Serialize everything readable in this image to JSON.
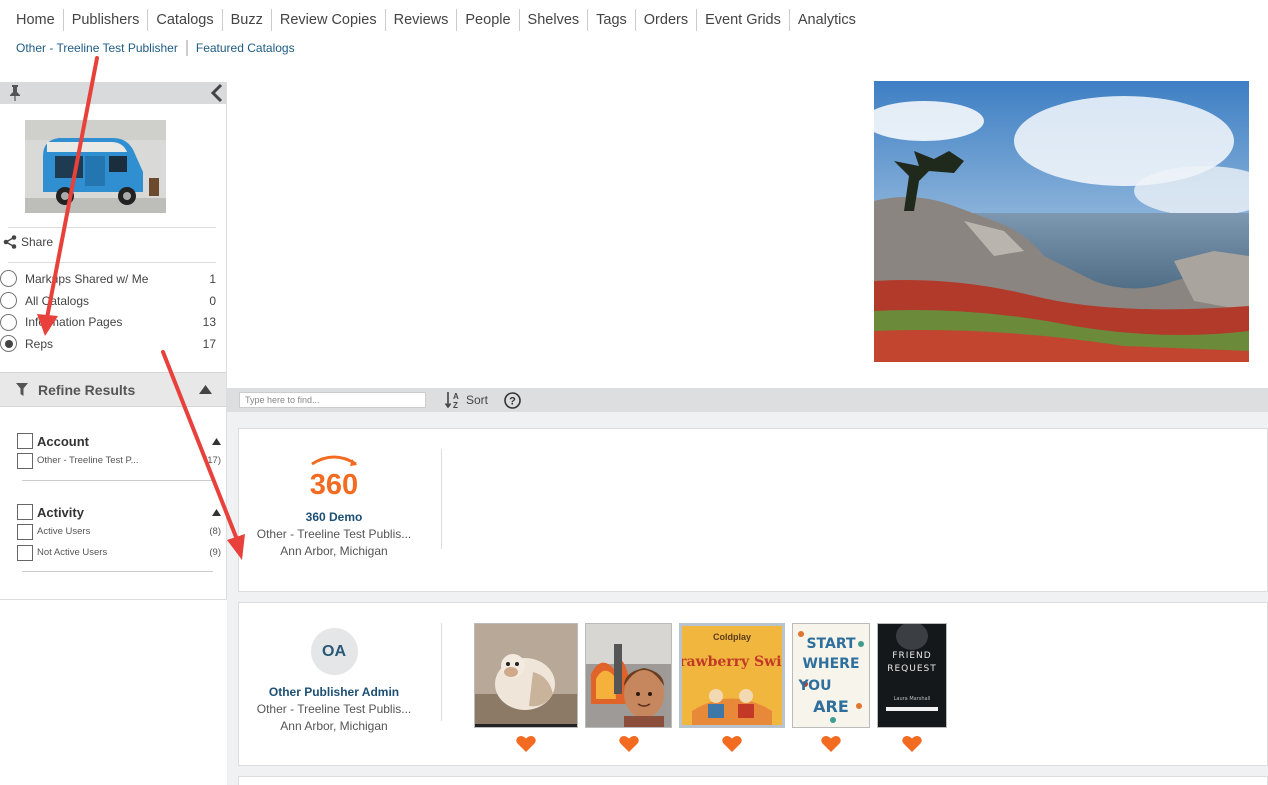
{
  "nav": {
    "items": [
      "Home",
      "Publishers",
      "Catalogs",
      "Buzz",
      "Review Copies",
      "Reviews",
      "People",
      "Shelves",
      "Tags",
      "Orders",
      "Event Grids",
      "Analytics"
    ]
  },
  "breadcrumb": [
    "Other - Treeline Test Publisher",
    "Featured Catalogs"
  ],
  "sidebar": {
    "share_label": "Share",
    "views": [
      {
        "label": "Markups Shared w/ Me",
        "count": "1",
        "checked": false
      },
      {
        "label": "All Catalogs",
        "count": "0",
        "checked": false
      },
      {
        "label": "Information Pages",
        "count": "13",
        "checked": false
      },
      {
        "label": "Reps",
        "count": "17",
        "checked": true
      }
    ],
    "refine_title": "Refine Results",
    "facets": [
      {
        "title": "Account",
        "options": [
          {
            "label": "Other - Treeline Test P...",
            "count": "(17)"
          }
        ]
      },
      {
        "title": "Activity",
        "options": [
          {
            "label": "Active Users",
            "count": "(8)"
          },
          {
            "label": "Not Active Users",
            "count": "(9)"
          }
        ]
      }
    ]
  },
  "toolbar": {
    "search_placeholder": "Type here to find...",
    "sort_label": "Sort"
  },
  "reps": [
    {
      "logo_text": "360",
      "name": "360 Demo",
      "org": "Other - Treeline Test Publis...",
      "location": "Ann Arbor, Michigan"
    },
    {
      "initials": "OA",
      "name": "Other Publisher Admin",
      "org": "Other - Treeline Test Publis...",
      "location": "Ann Arbor, Michigan",
      "books": [
        {
          "title": "",
          "author": ""
        },
        {
          "title": "",
          "author": ""
        },
        {
          "title": "Strawberry Swing",
          "author": "Coldplay"
        },
        {
          "title": "Start Where You Are",
          "author": ""
        },
        {
          "title": "Friend Request",
          "author": "Laura Marshall"
        }
      ]
    }
  ],
  "colors": {
    "link": "#1d5b84",
    "accent_orange": "#f26b21",
    "annotation_red": "#e8413b",
    "toolbar_bg": "#dcdedf"
  }
}
